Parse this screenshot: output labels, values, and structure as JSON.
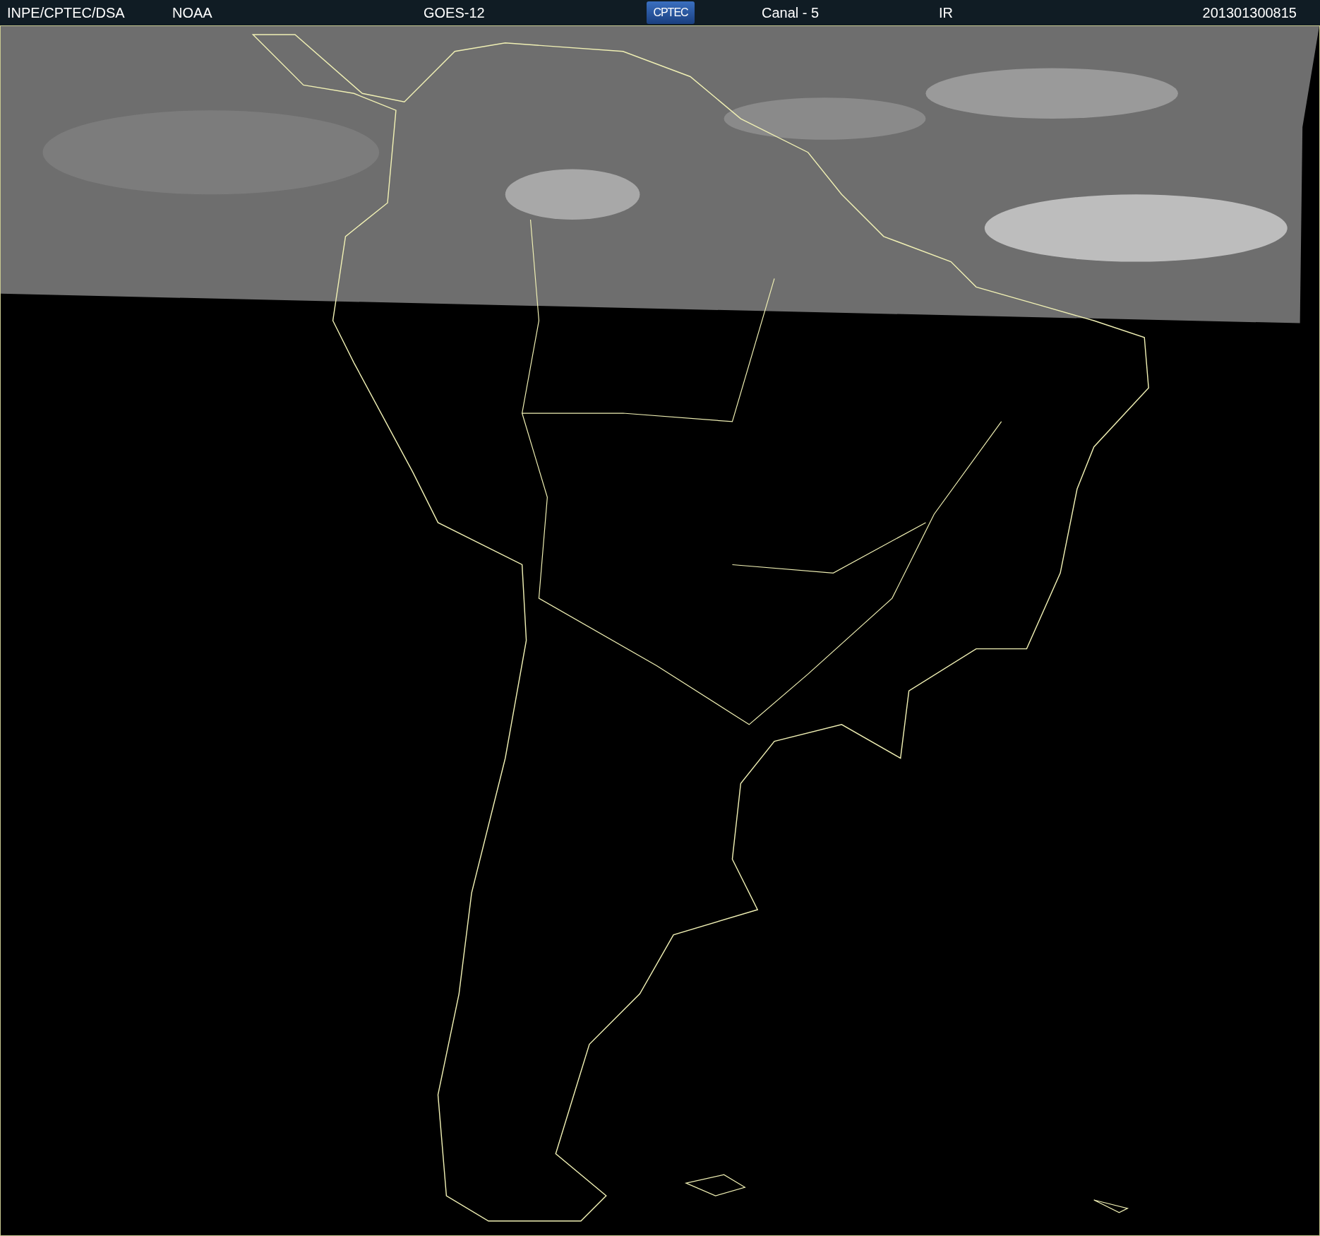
{
  "header": {
    "items": [
      {
        "kind": "text",
        "text": "INPE/CPTEC/DSA"
      },
      {
        "kind": "text",
        "text": "NOAA"
      },
      {
        "kind": "text",
        "text": "GOES-12"
      },
      {
        "kind": "logo",
        "text": "CPTEC"
      },
      {
        "kind": "text",
        "text": "Canal - 5"
      },
      {
        "kind": "text",
        "text": "IR"
      },
      {
        "kind": "text",
        "text": "201301300815"
      }
    ]
  }
}
